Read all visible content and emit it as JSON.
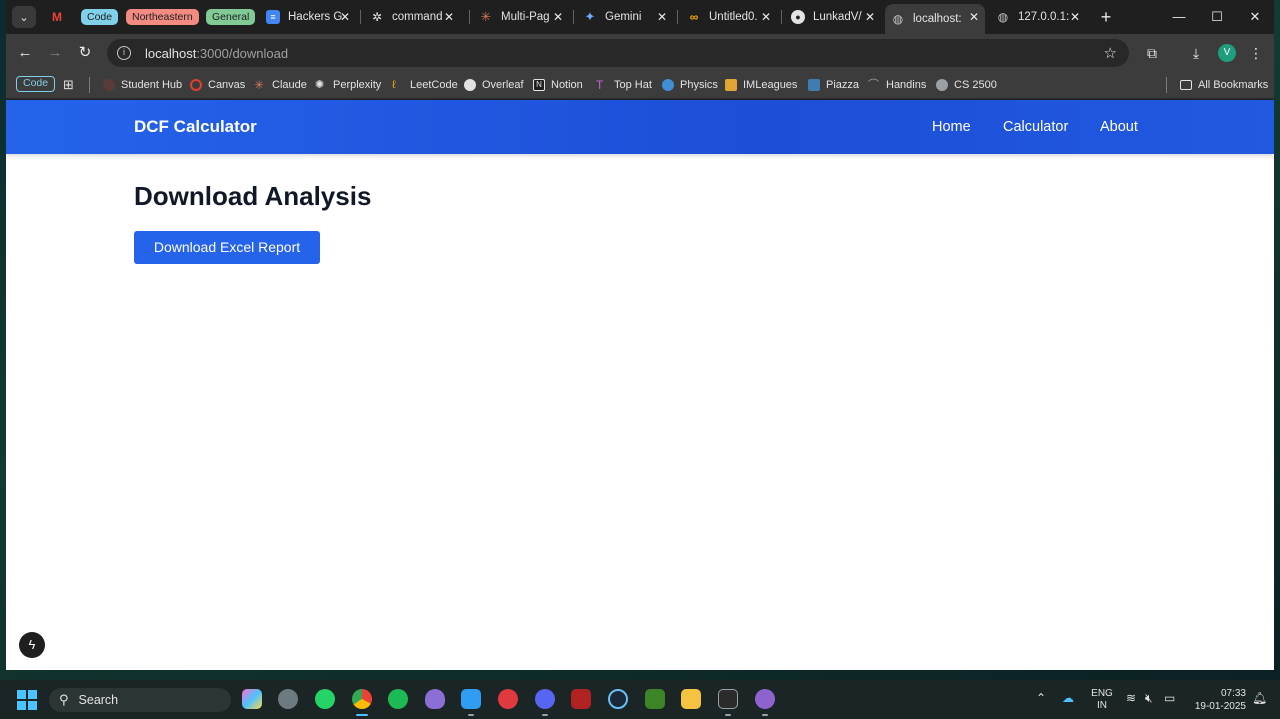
{
  "tabs": {
    "groups": [
      {
        "label": "Code",
        "color": "#7fd0e8"
      },
      {
        "label": "Northeastern",
        "color": "#f28b82"
      },
      {
        "label": "General",
        "color": "#81c995"
      }
    ],
    "items": [
      {
        "label": "Hackers G",
        "icon": "docs-icon"
      },
      {
        "label": "command",
        "icon": "openai-icon"
      },
      {
        "label": "Multi-Pag",
        "icon": "claude-icon"
      },
      {
        "label": "Gemini",
        "icon": "gemini-icon"
      },
      {
        "label": "Untitled0.",
        "icon": "colab-icon"
      },
      {
        "label": "LunkadV/",
        "icon": "github-icon"
      },
      {
        "label": "localhost:",
        "icon": "globe-icon"
      },
      {
        "label": "127.0.0.1:",
        "icon": "globe-icon"
      }
    ]
  },
  "omnibox": {
    "host": "localhost",
    "path": ":3000/download"
  },
  "bookmarks": {
    "code_chip": "Code",
    "items": [
      "Student Hub",
      "Canvas",
      "Claude",
      "Perplexity",
      "LeetCode",
      "Overleaf",
      "Notion",
      "Top Hat",
      "Physics",
      "IMLeagues",
      "Piazza",
      "Handins",
      "CS 2500"
    ],
    "all_bookmarks": "All Bookmarks"
  },
  "site": {
    "brand": "DCF Calculator",
    "nav": [
      "Home",
      "Calculator",
      "About"
    ],
    "page_title": "Download Analysis",
    "download_button": "Download Excel Report"
  },
  "taskbar": {
    "search_placeholder": "Search",
    "lang_top": "ENG",
    "lang_bottom": "IN",
    "time": "07:33",
    "date": "19-01-2025"
  },
  "colors": {
    "nav_blue": "#2563eb",
    "button_blue": "#2563eb",
    "title_text": "#111827"
  }
}
